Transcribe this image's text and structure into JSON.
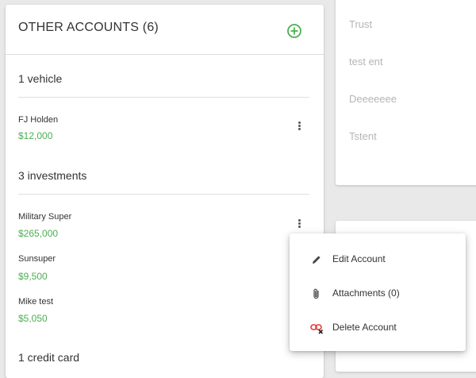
{
  "left_card": {
    "title": "OTHER ACCOUNTS (6)",
    "sections": [
      {
        "title": "1 vehicle",
        "accounts": [
          {
            "name": "FJ Holden",
            "value": "$12,000"
          }
        ]
      },
      {
        "title": "3 investments",
        "accounts": [
          {
            "name": "Military Super",
            "value": "$265,000"
          },
          {
            "name": "Sunsuper",
            "value": "$9,500"
          },
          {
            "name": "Mike test",
            "value": "$5,050"
          }
        ]
      },
      {
        "title": "1 credit card",
        "accounts": []
      }
    ]
  },
  "right_card": {
    "items": [
      "Trust",
      "test ent",
      "Deeeeeee",
      "Tstent"
    ]
  },
  "context_menu": {
    "items": [
      {
        "label": "Edit Account",
        "icon": "pencil-icon"
      },
      {
        "label": "Attachments (0)",
        "icon": "paperclip-icon"
      },
      {
        "label": "Delete Account",
        "icon": "unlink-delete-icon"
      }
    ]
  },
  "colors": {
    "accent_green": "#4caf50",
    "delete_red": "#e53935"
  }
}
